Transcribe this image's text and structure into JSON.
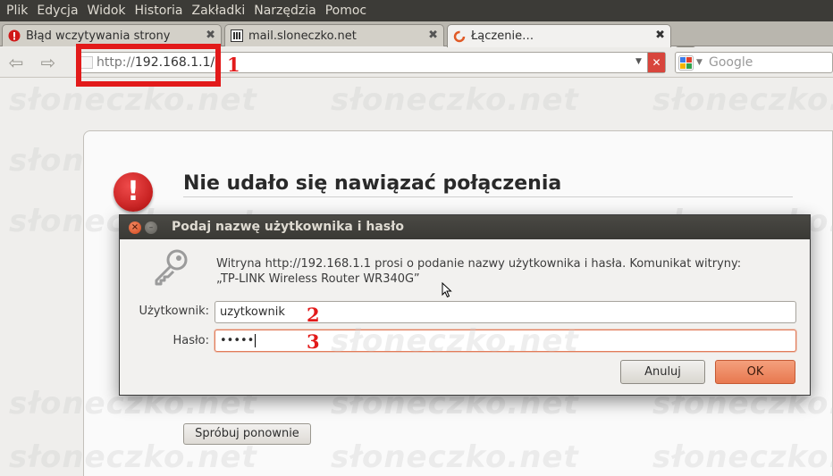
{
  "menubar": {
    "items": [
      "Plik",
      "Edycja",
      "Widok",
      "Historia",
      "Zakładki",
      "Narzędzia",
      "Pomoc"
    ]
  },
  "tabs": [
    {
      "label": "Błąd wczytywania strony",
      "icon": "error-icon",
      "active": false
    },
    {
      "label": "mail.sloneczko.net",
      "icon": "mail-favicon",
      "active": false
    },
    {
      "label": "Łączenie…",
      "icon": "loading-icon",
      "active": true
    }
  ],
  "tab_close_glyph": "✖",
  "new_tab_glyph": "+",
  "navbar": {
    "back_glyph": "⇦",
    "forward_glyph": "⇨",
    "url_protocol": "http://",
    "url_rest": "192.168.1.1/",
    "stop_glyph": "✕",
    "search_placeholder": "Google"
  },
  "annotations": [
    "1",
    "2",
    "3"
  ],
  "watermark_text": "słoneczko.net",
  "error_page": {
    "title": "Nie udało się nawiązać połączenia",
    "icon": "!",
    "retry_label": "Spróbuj ponownie"
  },
  "dialog": {
    "title": "Podaj nazwę użytkownika i hasło",
    "message_line1": "Witryna http://192.168.1.1 prosi o podanie nazwy użytkownika i hasła. Komunikat witryny:",
    "message_line2": "„TP-LINK Wireless Router WR340G”",
    "username_label": "Użytkownik:",
    "username_value": "uzytkownik",
    "password_label": "Hasło:",
    "password_value": "•••••",
    "cancel_label": "Anuluj",
    "ok_label": "OK",
    "close_glyph": "×",
    "min_glyph": "–"
  },
  "colors": {
    "annotation_red": "#e21a1a",
    "ok_orange": "#e8784f",
    "menubar": "#3c3b37"
  }
}
